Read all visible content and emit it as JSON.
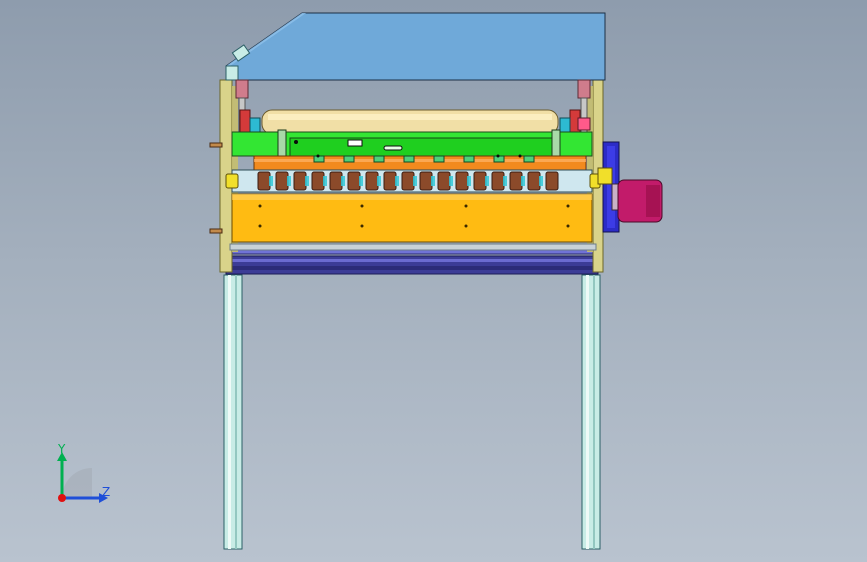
{
  "viewport": {
    "background_top": "#8e9cad",
    "background_bottom": "#b9c3cf"
  },
  "triad": {
    "y_label": "Y",
    "z_label": "Z",
    "y_color": "#00b050",
    "z_color": "#1f4fd8",
    "x_color": "#e01010"
  },
  "model": {
    "icons": [
      "hood-cover-icon",
      "feed-roller-icon",
      "cutter-blade-row-icon",
      "pressure-plate-icon",
      "gear-motor-icon",
      "frame-leg-icon"
    ],
    "colors": {
      "hood": "#6fa9d9",
      "frame": "#d9d38a",
      "roller": "#f1dfa6",
      "green_bar": "#33e633",
      "orange_bar": "#f28a1e",
      "yellow_plate": "#ffbb12",
      "motor": "#c21b6a",
      "base_beam": "#3c3c96",
      "legs": "#c8ece6"
    }
  }
}
